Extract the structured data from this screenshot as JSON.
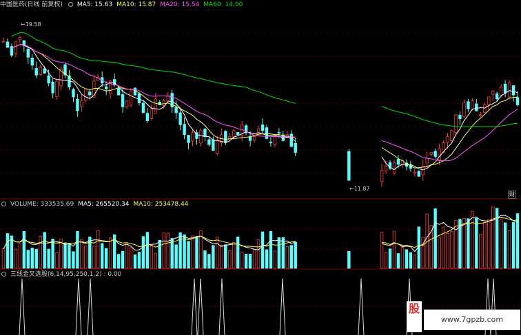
{
  "price_panel": {
    "title": "中国医药(日线 前复权)",
    "ma5": "MA5: 15.63",
    "ma10": "MA10: 15.87",
    "ma20": "MA20: 15.54",
    "ma60": "MA60: 14.00",
    "high_label": "19.58",
    "low_label": "11.87",
    "fin_badge": "财"
  },
  "volume_panel": {
    "title": "VOLUME: 333535.69",
    "ma5": "MA5: 265520.34",
    "ma10": "MA10: 253478.44"
  },
  "indicator_panel": {
    "title": "三线金叉选股(6,14,95,250,1,2) : 0.00"
  },
  "watermark": {
    "char": "股",
    "url": "www.7gpzb.com"
  },
  "colors": {
    "up": "#ff3b3b",
    "down": "#54ffff",
    "ma5": "#ffffff",
    "ma10": "#ffff55",
    "ma20": "#ff55ff",
    "ma60": "#00dd00",
    "grid": "#7a0000"
  },
  "chart_data": {
    "type": "candlestick",
    "price_min": 11.0,
    "price_max": 20.5,
    "closes": [
      18.9,
      18.6,
      18.2,
      18.9,
      19.1,
      18.7,
      18.1,
      17.7,
      17.2,
      17.6,
      17.3,
      16.8,
      16.3,
      16.9,
      17.5,
      17.2,
      16.6,
      16.1,
      15.4,
      15.9,
      16.5,
      16.2,
      16.9,
      17.1,
      16.8,
      16.5,
      16.9,
      16.7,
      16.2,
      15.6,
      15.9,
      16.4,
      16.2,
      15.8,
      15.3,
      14.9,
      15.5,
      16.0,
      15.7,
      15.9,
      16.2,
      15.6,
      15.3,
      14.7,
      14.2,
      13.8,
      14.3,
      14.0,
      14.4,
      14.1,
      13.7,
      13.4,
      13.9,
      14.2,
      13.8,
      14.1,
      14.4,
      14.2,
      14.7,
      14.3,
      13.9,
      14.1,
      14.5,
      14.4,
      14.0,
      13.8,
      14.1,
      14.3,
      13.9,
      14.2,
      13.6,
      13.3,
      null,
      null,
      null,
      null,
      null,
      null,
      null,
      null,
      null,
      null,
      null,
      null,
      11.9,
      null,
      null,
      null,
      null,
      null,
      null,
      null,
      12.4,
      12.6,
      12.5,
      12.8,
      12.7,
      12.9,
      12.6,
      12.5,
      12.3,
      12.1,
      12.6,
      13.0,
      13.3,
      13.1,
      13.5,
      13.8,
      14.1,
      14.4,
      15.2,
      15.0,
      15.8,
      15.5,
      15.9,
      15.4,
      15.2,
      15.7,
      16.1,
      16.4,
      16.0,
      16.6,
      16.3,
      16.8,
      16.2,
      15.7
    ]
  }
}
